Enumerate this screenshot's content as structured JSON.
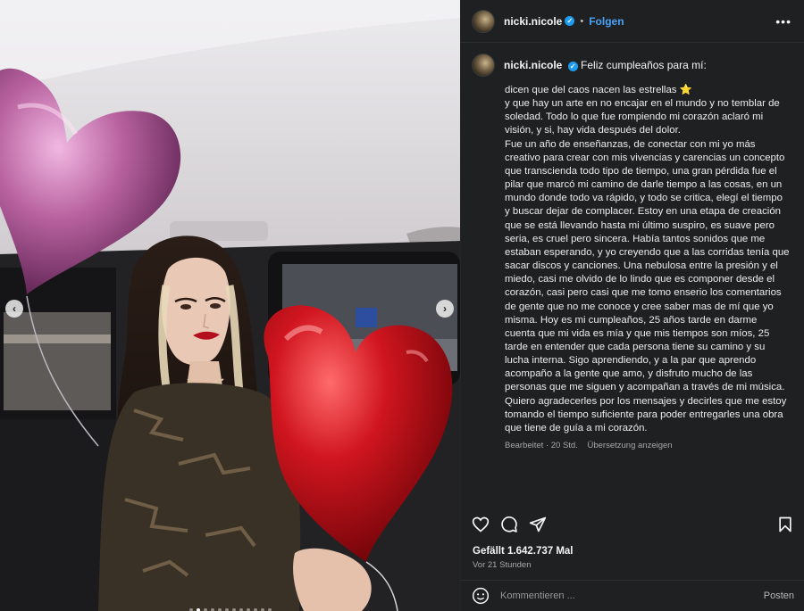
{
  "header": {
    "username": "nicki.nicole",
    "separator": "•",
    "follow_label": "Folgen",
    "more_icon": "more-horizontal-icon"
  },
  "caption": {
    "username": "nicki.nicole",
    "title": "Feliz cumpleaños para mí:",
    "line1": "dicen que del caos nacen las estrellas ",
    "star": "⭐",
    "body": "y que hay un arte en no encajar en el mundo y no temblar de soledad. Todo lo que fue rompiendo mi corazón aclaró mi visión, y si, hay vida después del dolor.\nFue un año de enseñanzas, de conectar con mi yo más creativo para crear con mis vivencias y carencias un concepto que transcienda todo tipo de tiempo, una gran pérdida fue el pilar que marcó mi camino de darle tiempo a las cosas, en un mundo donde todo va rápido, y todo se critica, elegí el tiempo y buscar dejar de complacer. Estoy en una etapa de creación que se está llevando hasta mi último suspiro, es suave pero seria, es cruel pero sincera. Había tantos sonidos que me estaban esperando, y yo creyendo que a las corridas tenía que sacar discos y canciones. Una nebulosa entre la presión y el miedo, casi me olvido de lo lindo que es componer desde el corazón, casi pero casi que me tomo enserio los comentarios de gente que no me conoce y cree saber mas de mí que yo misma. Hoy es mi cumpleaños, 25 años tarde en darme cuenta que mi vida es mía y que mis tiempos son míos, 25 tarde en entender que cada persona tiene su camino y su lucha interna. Sigo aprendiendo, y a la par que aprendo acompaño a la gente que amo, y disfruto mucho de las personas que me siguen y acompañan a través de mi música. Quiero agradecerles por los mensajes y decirles que me estoy tomando el tiempo suficiente para poder entregarles una obra que tiene de guía a mi corazón.",
    "edited": "Bearbeitet · 20 Std.",
    "translate_label": "Übersetzung anzeigen"
  },
  "actions": {
    "likes": "Gefällt 1.642.737 Mal",
    "time": "Vor 21 Stunden"
  },
  "comment": {
    "placeholder": "Kommentieren ...",
    "post_label": "Posten"
  },
  "carousel": {
    "prev_icon": "chevron-left-icon",
    "next_icon": "chevron-right-icon",
    "prev_glyph": "‹",
    "next_glyph": "›",
    "slide_count": 12,
    "active_index": 1
  },
  "colors": {
    "panel_bg": "#1f2022",
    "follow_blue": "#4aa3f6",
    "verified_blue": "#1d9bf0",
    "balloon_red": "#d0151f",
    "balloon_pink": "#b8629f"
  }
}
